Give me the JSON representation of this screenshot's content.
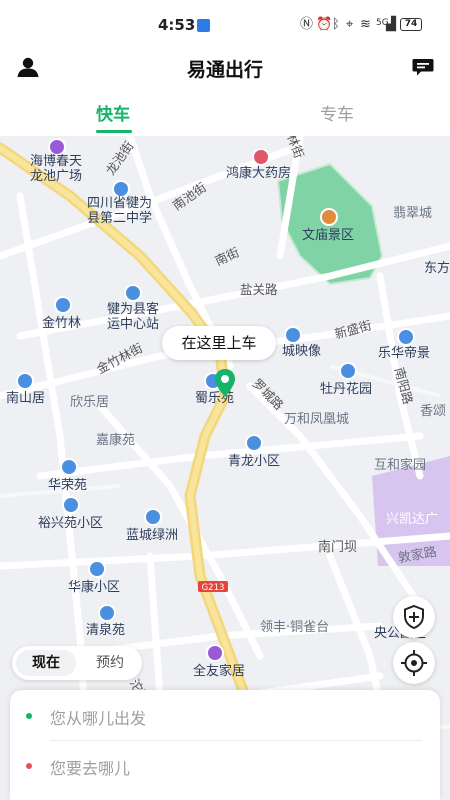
{
  "status_bar": {
    "time": "4:53",
    "battery": "74",
    "network": "5G"
  },
  "header": {
    "title": "易通出行"
  },
  "tabs": [
    {
      "label": "快车",
      "active": true
    },
    {
      "label": "专车",
      "active": false
    }
  ],
  "colors": {
    "accent": "#15b46a",
    "origin_dot": "#15b46a",
    "destination_dot": "#e35353"
  },
  "map": {
    "pickup_prompt": "在这里上车",
    "places": [
      "海博春天\n龙池广场",
      "四川省犍为\n县第二中学",
      "鸿康大药房",
      "翡翠城",
      "文庙景区",
      "东方",
      "金竹林",
      "犍为县客\n运中心站",
      "城映像",
      "乐华帝景",
      "南山居",
      "欣乐居",
      "蜀乐苑",
      "牡丹花园",
      "香颂",
      "万和凤凰城",
      "嘉康苑",
      "青龙小区",
      "互和家园",
      "华荣苑",
      "兴凯达广",
      "裕兴苑小区",
      "蓝城绿洲",
      "南门坝",
      "敦家路",
      "华康小区",
      "清泉苑",
      "领丰·铜雀台",
      "央公园区",
      "全友家居"
    ],
    "roads": [
      "龙池街",
      "南池街",
      "林街",
      "南街",
      "盐关路",
      "新盛街",
      "金竹林街",
      "罗城路",
      "南阳路",
      "G213",
      "沱路"
    ]
  },
  "time_mode": {
    "now": "现在",
    "book": "预约"
  },
  "address": {
    "from_placeholder": "您从哪儿出发",
    "to_placeholder": "您要去哪儿"
  }
}
